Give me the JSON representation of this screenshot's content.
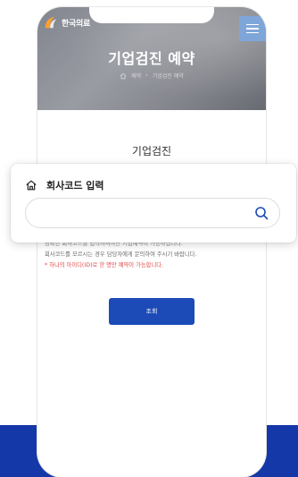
{
  "logo": {
    "text": "한국의료"
  },
  "hero": {
    "title": "기업검진 예약",
    "breadcrumb": [
      "예약",
      "기업검진 예약"
    ]
  },
  "section_title": "기업검진",
  "company_code": {
    "label": "회사코드 입력",
    "value": "",
    "placeholder": ""
  },
  "info": {
    "line1": "정확한 회사코드를 입력하셔야만 기업예약이 가능하십니다.",
    "line2": "회사코드를 모르시는 경우 담당자에게 문의하여 주시기 바랍니다.",
    "line3": "* 하나의 아이디(ID)로 한 명만 예약이 가능합니다."
  },
  "buttons": {
    "query": "조회"
  },
  "colors": {
    "primary": "#1c4bb8",
    "bottom_band": "#1438a8",
    "menu": "#7fa6d8",
    "warning": "#e14a4a"
  },
  "icons": {
    "logo": "logo-swirl-icon",
    "menu": "hamburger-menu-icon",
    "breadcrumb_home": "home-icon",
    "card_home": "home-icon",
    "search": "search-icon"
  }
}
